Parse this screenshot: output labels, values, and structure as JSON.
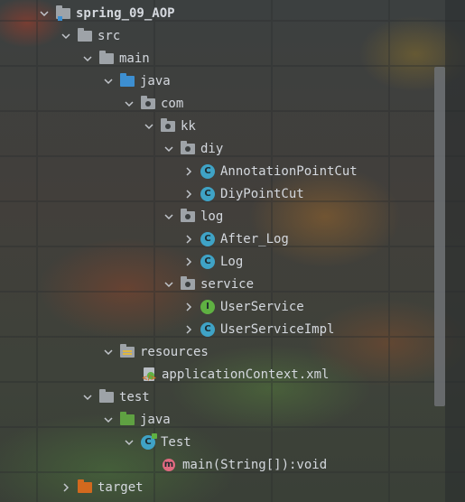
{
  "project_tree": {
    "nodes": [
      {
        "label": "spring_09_AOP",
        "expanded": true,
        "icon": "module-folder-icon"
      },
      {
        "label": "src",
        "expanded": true,
        "icon": "folder-icon"
      },
      {
        "label": "main",
        "expanded": true,
        "icon": "folder-icon"
      },
      {
        "label": "java",
        "expanded": true,
        "icon": "source-root-icon"
      },
      {
        "label": "com",
        "expanded": true,
        "icon": "package-icon"
      },
      {
        "label": "kk",
        "expanded": true,
        "icon": "package-icon"
      },
      {
        "label": "diy",
        "expanded": true,
        "icon": "package-icon"
      },
      {
        "label": "AnnotationPointCut",
        "expanded": false,
        "icon": "class-icon",
        "badge": "C"
      },
      {
        "label": "DiyPointCut",
        "expanded": false,
        "icon": "class-icon",
        "badge": "C"
      },
      {
        "label": "log",
        "expanded": true,
        "icon": "package-icon"
      },
      {
        "label": "After_Log",
        "expanded": false,
        "icon": "class-icon",
        "badge": "C"
      },
      {
        "label": "Log",
        "expanded": false,
        "icon": "class-icon",
        "badge": "C"
      },
      {
        "label": "service",
        "expanded": true,
        "icon": "package-icon"
      },
      {
        "label": "UserService",
        "expanded": false,
        "icon": "interface-icon",
        "badge": "I"
      },
      {
        "label": "UserServiceImpl",
        "expanded": false,
        "icon": "class-icon",
        "badge": "C"
      },
      {
        "label": "resources",
        "expanded": false,
        "icon": "resources-folder-icon"
      },
      {
        "label": "applicationContext.xml",
        "icon": "spring-xml-file-icon"
      },
      {
        "label": "test",
        "expanded": true,
        "icon": "folder-icon"
      },
      {
        "label": "java",
        "expanded": true,
        "icon": "test-source-root-icon"
      },
      {
        "label": "Test",
        "expanded": true,
        "icon": "runnable-class-icon",
        "badge": "C"
      },
      {
        "label": "main(String[]):void",
        "icon": "method-icon",
        "badge": "m"
      },
      {
        "label": "target",
        "expanded": false,
        "icon": "excluded-folder-icon"
      }
    ]
  },
  "colors": {
    "class_badge": "#3fa3c6",
    "interface_badge": "#5fb142",
    "method_badge": "#e06a80",
    "source_folder": "#3d8fd1",
    "test_folder": "#5fa142",
    "excluded_folder": "#d2691e"
  }
}
